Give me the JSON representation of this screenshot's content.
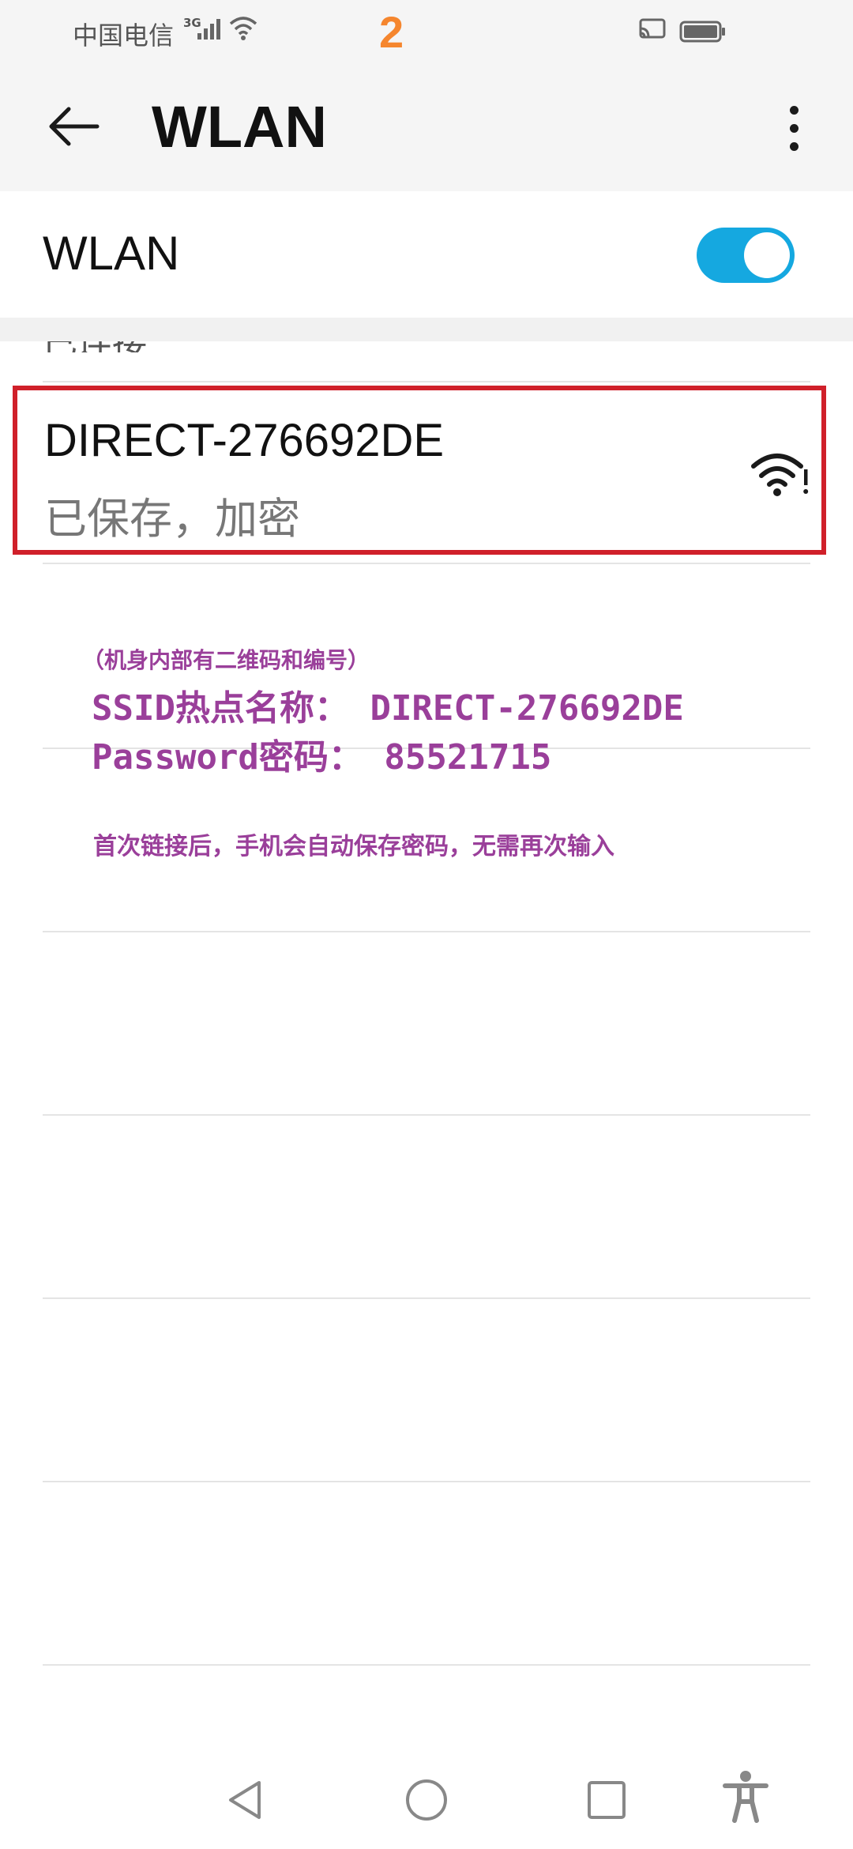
{
  "status_bar": {
    "carrier": "中国电信",
    "network_type": "3G",
    "step_number": "2",
    "icons": [
      "signal-icon",
      "wifi-icon",
      "cast-icon",
      "battery-icon"
    ]
  },
  "title_bar": {
    "title": "WLAN",
    "back_icon": "arrow-left-icon",
    "more_icon": "more-vertical-icon"
  },
  "wlan_toggle": {
    "label": "WLAN",
    "enabled": true,
    "accent_color": "#15a8e0"
  },
  "list": {
    "section_header": "已连接",
    "networks": [
      {
        "ssid": "DIRECT-276692DE",
        "status": "已保存，加密",
        "icon": "wifi-lock-icon"
      }
    ]
  },
  "annotations": {
    "qr_note": "（机身内部有二维码和编号）",
    "ssid_line": "SSID热点名称： DIRECT-276692DE",
    "password_line": "Password密码： 85521715",
    "saved_note": "首次链接后，手机会自动保存密码，无需再次输入",
    "highlight_color": "#d0202a",
    "text_color": "#9a3f9a"
  },
  "nav_bar": {
    "icons": [
      "nav-back-icon",
      "nav-home-icon",
      "nav-recents-icon",
      "accessibility-icon"
    ]
  }
}
